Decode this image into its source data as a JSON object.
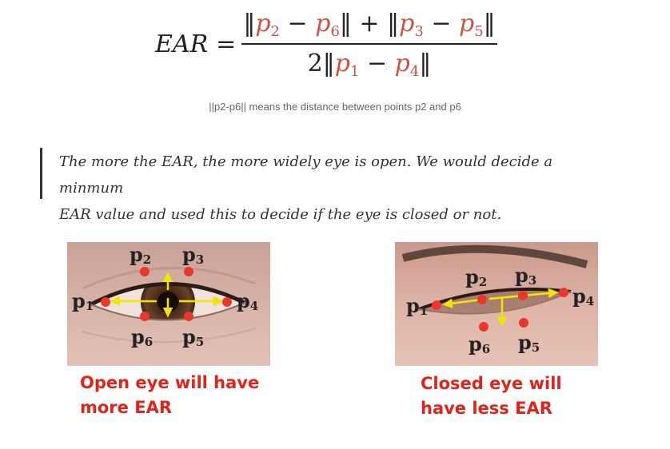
{
  "formula": {
    "lhs": "EAR",
    "equals": "=",
    "num_p2": "p",
    "num_p2_sub": "2",
    "num_p6": "p",
    "num_p6_sub": "6",
    "num_p3": "p",
    "num_p3_sub": "3",
    "num_p5": "p",
    "num_p5_sub": "5",
    "den_coef": "2",
    "den_p1": "p",
    "den_p1_sub": "1",
    "den_p4": "p",
    "den_p4_sub": "4"
  },
  "caption": "||p2-p6|| means the distance between points p2 and p6",
  "quote": {
    "line1": "The more the EAR, the more widely eye is open. We would decide a minmum",
    "line2": "EAR value and used this to decide if the eye is closed or not."
  },
  "open_eye": {
    "labels": {
      "p1": "p",
      "p1_sub": "1",
      "p2": "p",
      "p2_sub": "2",
      "p3": "p",
      "p3_sub": "3",
      "p4": "p",
      "p4_sub": "4",
      "p5": "p",
      "p5_sub": "5",
      "p6": "p",
      "p6_sub": "6"
    },
    "caption": "Open eye will have\nmore EAR"
  },
  "closed_eye": {
    "labels": {
      "p1": "p",
      "p1_sub": "1",
      "p2": "p",
      "p2_sub": "2",
      "p3": "p",
      "p3_sub": "3",
      "p4": "p",
      "p4_sub": "4",
      "p5": "p",
      "p5_sub": "5",
      "p6": "p",
      "p6_sub": "6"
    },
    "caption": "Closed eye will\nhave less EAR"
  },
  "colors": {
    "landmark": "#e8382c",
    "arrow": "#f2e600",
    "caption_red": "#e0241b",
    "formula_red": "#d0533f"
  }
}
